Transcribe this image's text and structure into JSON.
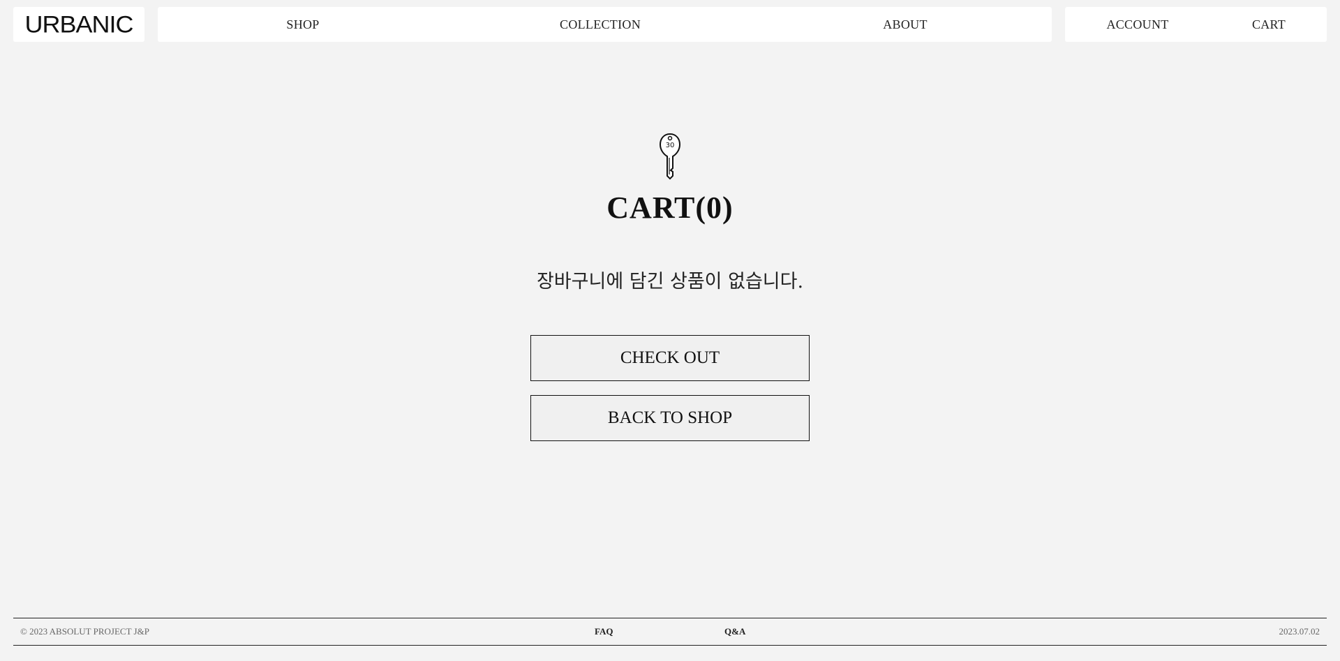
{
  "header": {
    "logo": "URBANIC",
    "nav": {
      "shop": "SHOP",
      "collection": "COLLECTION",
      "about": "ABOUT"
    },
    "side": {
      "account": "ACCOUNT",
      "cart": "CART"
    }
  },
  "main": {
    "icon": "key-icon",
    "key_tag": "30",
    "title": "CART(0)",
    "empty_message": "장바구니에 담긴 상품이 없습니다.",
    "checkout_label": "CHECK OUT",
    "back_label": "BACK TO SHOP"
  },
  "footer": {
    "copyright": "© 2023 ABSOLUT PROJECT J&P",
    "faq": "FAQ",
    "qna": "Q&A",
    "date": "2023.07.02"
  }
}
